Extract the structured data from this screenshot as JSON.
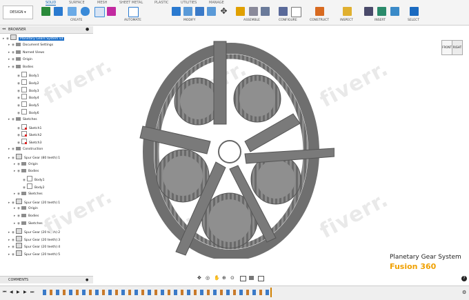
{
  "ribbon": {
    "workspace": "DESIGN",
    "tabs": [
      "SOLID",
      "SURFACE",
      "MESH",
      "SHEET METAL",
      "PLASTIC",
      "UTILITIES",
      "MANAGE"
    ],
    "active_tab": "SOLID",
    "groups": [
      "CREATE",
      "AUTOMATE",
      "MODIFY",
      "ASSEMBLE",
      "CONFIGURE",
      "CONSTRUCT",
      "INSPECT",
      "INSERT",
      "SELECT"
    ]
  },
  "browser": {
    "title": "BROWSER",
    "rows": [
      {
        "label": "Planetary Gears System v3",
        "indent": 0,
        "icon": "component",
        "selected": true
      },
      {
        "label": "Document Settings",
        "indent": 1,
        "icon": "folder"
      },
      {
        "label": "Named Views",
        "indent": 1,
        "icon": "folder"
      },
      {
        "label": "Origin",
        "indent": 1,
        "icon": "folder"
      },
      {
        "label": "Bodies",
        "indent": 1,
        "icon": "folder"
      },
      {
        "label": "Body1",
        "indent": 2,
        "icon": "body"
      },
      {
        "label": "Body2",
        "indent": 2,
        "icon": "body"
      },
      {
        "label": "Body3",
        "indent": 2,
        "icon": "body"
      },
      {
        "label": "Body4",
        "indent": 2,
        "icon": "body"
      },
      {
        "label": "Body5",
        "indent": 2,
        "icon": "body"
      },
      {
        "label": "Body6",
        "indent": 2,
        "icon": "body"
      },
      {
        "label": "Sketches",
        "indent": 1,
        "icon": "folder"
      },
      {
        "label": "Sketch1",
        "indent": 2,
        "icon": "sketch"
      },
      {
        "label": "Sketch2",
        "indent": 2,
        "icon": "sketch"
      },
      {
        "label": "Sketch3",
        "indent": 2,
        "icon": "sketch"
      },
      {
        "label": "Construction",
        "indent": 1,
        "icon": "folder"
      },
      {
        "label": "Spur Gear (80 teeth):1",
        "indent": 1,
        "icon": "component"
      },
      {
        "label": "Origin",
        "indent": 2,
        "icon": "folder"
      },
      {
        "label": "Bodies",
        "indent": 2,
        "icon": "folder"
      },
      {
        "label": "Body1",
        "indent": 3,
        "icon": "body"
      },
      {
        "label": "Body2",
        "indent": 3,
        "icon": "body"
      },
      {
        "label": "Sketches",
        "indent": 2,
        "icon": "folder"
      },
      {
        "label": "Spur Gear (20 teeth):1",
        "indent": 1,
        "icon": "component"
      },
      {
        "label": "Origin",
        "indent": 2,
        "icon": "folder"
      },
      {
        "label": "Bodies",
        "indent": 2,
        "icon": "folder"
      },
      {
        "label": "Sketches",
        "indent": 2,
        "icon": "folder"
      },
      {
        "label": "Spur Gear (20 teeth):2",
        "indent": 1,
        "icon": "component"
      },
      {
        "label": "Spur Gear (20 teeth):3",
        "indent": 1,
        "icon": "component"
      },
      {
        "label": "Spur Gear (20 teeth):4",
        "indent": 1,
        "icon": "component"
      },
      {
        "label": "Spur Gear (20 teeth):5",
        "indent": 1,
        "icon": "component"
      }
    ]
  },
  "comments": {
    "title": "COMMENTS"
  },
  "viewcube": {
    "front": "FRONT",
    "right": "RIGHT"
  },
  "caption": {
    "line1": "Planetary Gear System",
    "line2": "Fusion 360"
  },
  "watermark": "fiverr.",
  "colors": {
    "accent": "#0a64b4",
    "caption_gold": "#f0a000",
    "gear": "#8a8a8a"
  }
}
